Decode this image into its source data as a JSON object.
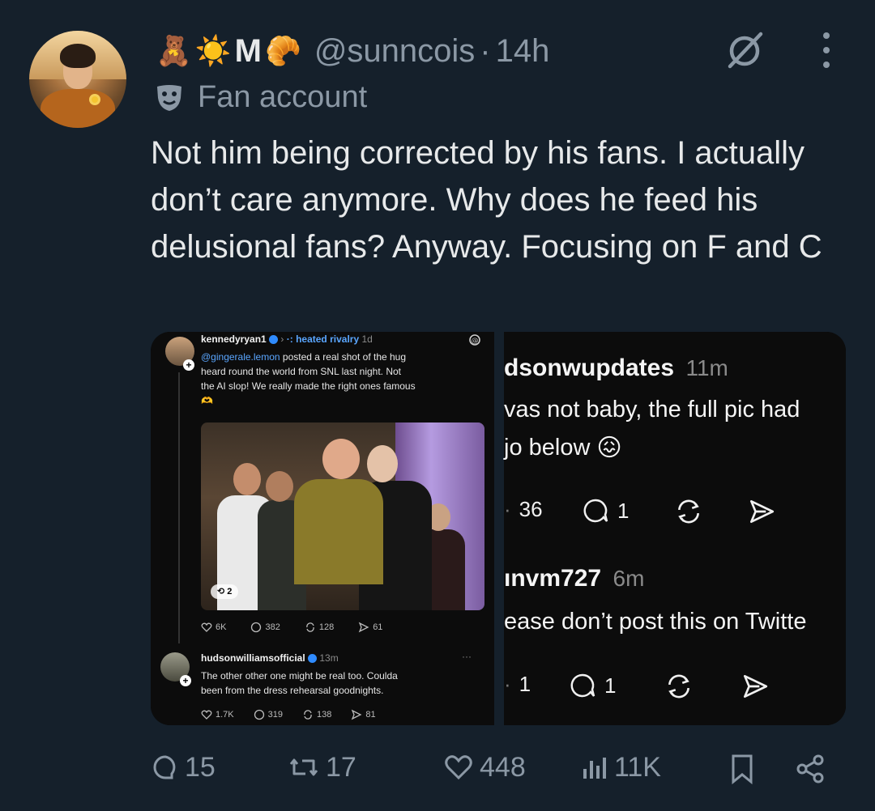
{
  "tweet": {
    "display_name_emojis": [
      "🧸",
      "☀️"
    ],
    "display_name_letter": "M",
    "display_name_emoji_after": "🥐",
    "handle": "@sunncois",
    "separator": "·",
    "time": "14h",
    "label_icon": "theater-masks-icon",
    "label": "Fan account",
    "text": "Not him being corrected by his fans. I actually don’t care anymore. Why does he feed his delusional fans? Anyway. Focusing on F and C"
  },
  "left_screenshot": {
    "post1": {
      "username": "kennedyryan1",
      "thread_name": "·: heated rivalry",
      "time": "1d",
      "mention": "@gingerale.lemon",
      "text_line1_rest": " posted a real shot of the hug",
      "text_line2": "heard round the world from SNL last night. Not",
      "text_line3": "the AI slop! We really made the right ones famous",
      "emoji": "🫶",
      "image_counter": "2",
      "likes": "6K",
      "comments": "382",
      "reposts": "128",
      "shares": "61"
    },
    "post2": {
      "username": "hudsonwilliamsofficial",
      "time": "13m",
      "text_line1": "The other other one might be real too. Coulda",
      "text_line2": "been from the dress rehearsal goodnights.",
      "likes": "1.7K",
      "comments": "319",
      "reposts": "138",
      "shares": "81"
    }
  },
  "right_screenshot": {
    "post1": {
      "username": "dsonwupdates",
      "time": "11m",
      "text_line1": "vas not baby, the full pic had",
      "text_line2": "jo below",
      "emoji": "😖",
      "likes": "36",
      "comments": "1"
    },
    "post2": {
      "username": "ınvm727",
      "time": "6m",
      "text_line1": "ease don’t post this on Twitte",
      "likes": "1",
      "comments": "1"
    }
  },
  "footer": {
    "replies": "15",
    "retweets": "17",
    "likes": "448",
    "views": "11K"
  },
  "colors": {
    "background": "#15202b",
    "text_primary": "#e7e9ea",
    "text_secondary": "#8b98a5",
    "link_blue": "#5aa6ff"
  }
}
